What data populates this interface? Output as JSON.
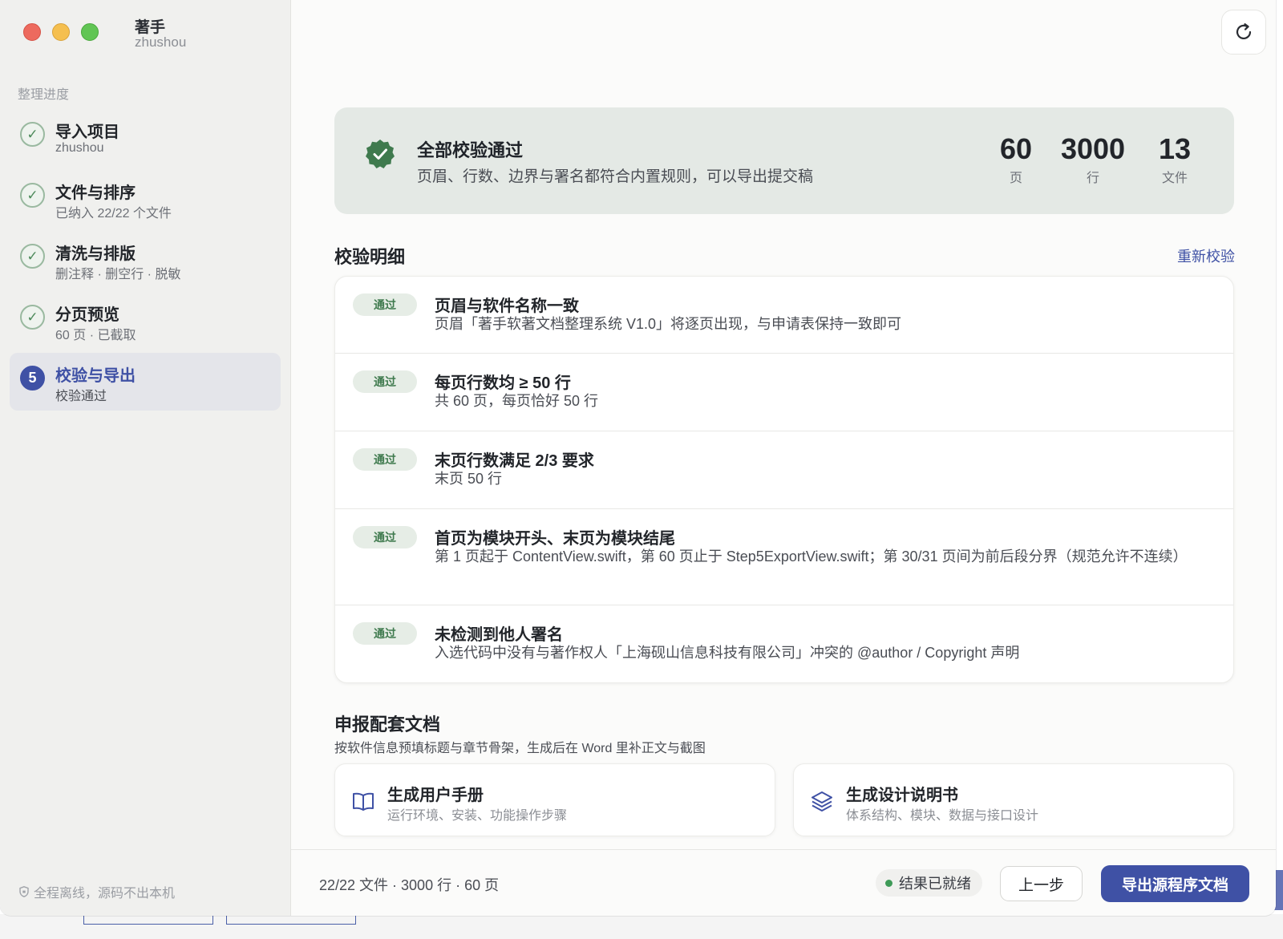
{
  "app": {
    "title": "著手",
    "subtitle": "zhushou"
  },
  "sidebar": {
    "section_label": "整理进度",
    "steps": [
      {
        "title": "导入项目",
        "sub": "zhushou",
        "status": "done"
      },
      {
        "title": "文件与排序",
        "sub": "已纳入 22/22 个文件",
        "status": "done"
      },
      {
        "title": "清洗与排版",
        "sub": "删注释 · 删空行 · 脱敏",
        "status": "done"
      },
      {
        "title": "分页预览",
        "sub": "60 页 · 已截取",
        "status": "done"
      },
      {
        "title": "校验与导出",
        "sub": "校验通过",
        "status": "active",
        "number": "5"
      }
    ],
    "footer_note": "全程离线，源码不出本机"
  },
  "summary": {
    "title": "全部校验通过",
    "subtitle": "页眉、行数、边界与署名都符合内置规则，可以导出提交稿",
    "stats": [
      {
        "value": "60",
        "unit": "页"
      },
      {
        "value": "3000",
        "unit": "行"
      },
      {
        "value": "13",
        "unit": "文件"
      }
    ]
  },
  "details": {
    "heading": "校验明细",
    "recheck_label": "重新校验",
    "items": [
      {
        "badge": "通过",
        "title": "页眉与软件名称一致",
        "desc": "页眉「著手软著文档整理系统 V1.0」将逐页出现，与申请表保持一致即可"
      },
      {
        "badge": "通过",
        "title": "每页行数均 ≥ 50 行",
        "desc": "共 60 页，每页恰好 50 行"
      },
      {
        "badge": "通过",
        "title": "末页行数满足 2/3 要求",
        "desc": "末页 50 行"
      },
      {
        "badge": "通过",
        "title": "首页为模块开头、末页为模块结尾",
        "desc": "第 1 页起于 ContentView.swift，第 60 页止于 Step5ExportView.swift；第 30/31 页间为前后段分界（规范允许不连续）"
      },
      {
        "badge": "通过",
        "title": "未检测到他人署名",
        "desc": "入选代码中没有与著作权人「上海砚山信息科技有限公司」冲突的 @author / Copyright 声明"
      }
    ]
  },
  "docs": {
    "heading": "申报配套文档",
    "subtitle": "按软件信息预填标题与章节骨架，生成后在 Word 里补正文与截图",
    "cards": [
      {
        "title": "生成用户手册",
        "sub": "运行环境、安装、功能操作步骤",
        "icon": "book-icon"
      },
      {
        "title": "生成设计说明书",
        "sub": "体系结构、模块、数据与接口设计",
        "icon": "layers-icon"
      }
    ]
  },
  "footer": {
    "summary": "22/22 文件 · 3000 行 · 60 页",
    "status": "结果已就绪",
    "prev_label": "上一步",
    "export_label": "导出源程序文档"
  },
  "colors": {
    "accent": "#3f51a5",
    "success": "#3e9a57",
    "summary_bg": "#e4e9e5"
  }
}
